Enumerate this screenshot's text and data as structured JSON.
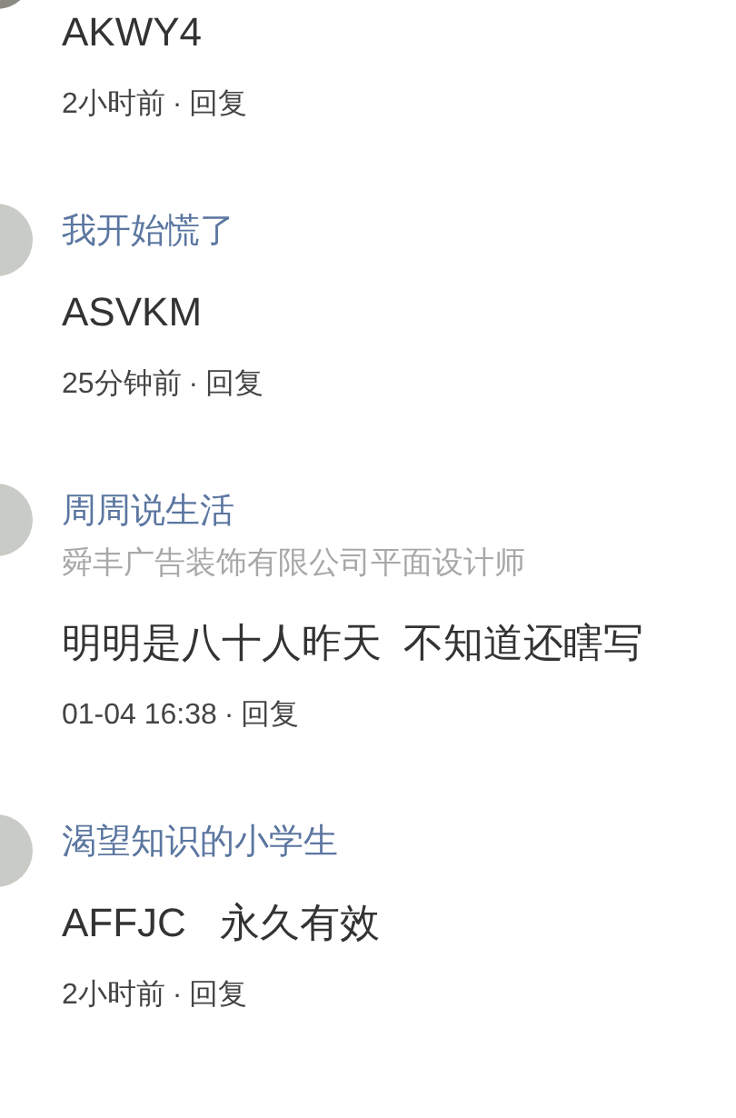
{
  "comments": [
    {
      "text": "AKWY4",
      "time": "2小时前",
      "separator": "·",
      "reply": "回复"
    },
    {
      "name": "我开始慌了",
      "text": "ASVKM",
      "time": "25分钟前",
      "separator": "·",
      "reply": "回复"
    },
    {
      "name": "周周说生活",
      "subtitle": "舜丰广告装饰有限公司平面设计师",
      "text": "明明是八十人昨天  不知道还瞎写",
      "time": "01-04 16:38",
      "separator": "·",
      "reply": "回复"
    },
    {
      "name": "渴望知识的小学生",
      "text": "AFFJC   永久有效",
      "time": "2小时前",
      "separator": "·",
      "reply": "回复"
    }
  ]
}
